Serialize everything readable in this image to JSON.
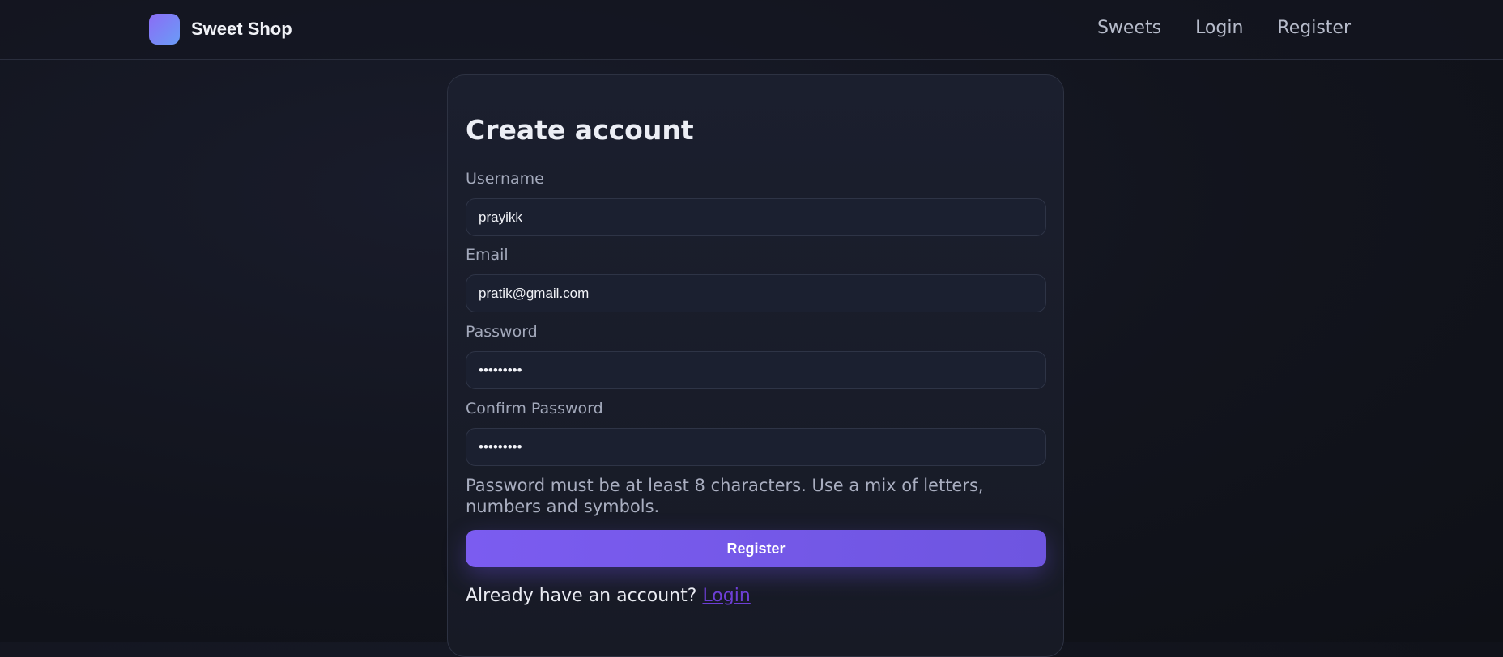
{
  "app": {
    "brand_name": "Sweet Shop",
    "nav": [
      "Sweets",
      "Login",
      "Register"
    ]
  },
  "form": {
    "title": "Create account",
    "fields": [
      {
        "label": "Username",
        "value": "prayikk",
        "type": "text"
      },
      {
        "label": "Email",
        "value": "pratik@gmail.com",
        "type": "email"
      },
      {
        "label": "Password",
        "value": "•••••••••",
        "type": "password"
      },
      {
        "label": "Confirm Password",
        "value": "•••••••••",
        "type": "password"
      }
    ],
    "hint": "Password must be at least 8 characters. Use a mix of letters, numbers and symbols.",
    "submit_label": "Register",
    "footer_text": "Already have an account?",
    "footer_link": "Login"
  },
  "colors": {
    "accent": "#7359ea",
    "link": "#6d3fd6",
    "background": "#12141d"
  }
}
